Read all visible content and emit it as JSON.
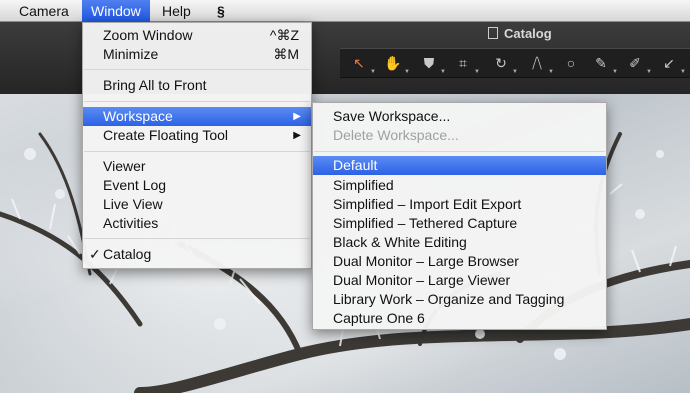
{
  "menubar": {
    "items": [
      {
        "label": "Camera"
      },
      {
        "label": "Window"
      },
      {
        "label": "Help"
      }
    ],
    "script_icon": "script-menu-icon"
  },
  "window": {
    "title": "Catalog"
  },
  "toolbar": {
    "tools": [
      {
        "icon": "cursor-icon",
        "glyph": "↖"
      },
      {
        "icon": "hand-icon",
        "glyph": "✋"
      },
      {
        "icon": "stamp-icon",
        "glyph": "⛊"
      },
      {
        "icon": "crop-icon",
        "glyph": "⌗"
      },
      {
        "icon": "rotate-icon",
        "glyph": "↻"
      },
      {
        "icon": "keystone-icon",
        "glyph": "⧸⧹"
      },
      {
        "icon": "spot-icon",
        "glyph": "○"
      },
      {
        "icon": "brush-icon",
        "glyph": "✎"
      },
      {
        "icon": "picker-icon",
        "glyph": "✐"
      },
      {
        "icon": "arrow-icon",
        "glyph": "↙"
      }
    ]
  },
  "window_menu": {
    "items": [
      {
        "label": "Zoom Window",
        "shortcut": "^⌘Z"
      },
      {
        "label": "Minimize",
        "shortcut": "⌘M"
      },
      {
        "label": "Bring All to Front"
      },
      {
        "label": "Workspace"
      },
      {
        "label": "Create Floating Tool"
      },
      {
        "label": "Viewer"
      },
      {
        "label": "Event Log"
      },
      {
        "label": "Live View"
      },
      {
        "label": "Activities"
      },
      {
        "label": "Catalog",
        "check": "✓"
      }
    ],
    "submenu_arrow": "▶"
  },
  "workspace_menu": {
    "items": [
      {
        "label": "Save Workspace..."
      },
      {
        "label": "Delete Workspace..."
      },
      {
        "label": "Default"
      },
      {
        "label": "Simplified"
      },
      {
        "label": "Simplified – Import Edit Export"
      },
      {
        "label": "Simplified – Tethered Capture"
      },
      {
        "label": "Black & White Editing"
      },
      {
        "label": "Dual Monitor – Large Browser"
      },
      {
        "label": "Dual Monitor – Large Viewer"
      },
      {
        "label": "Library Work – Organize and Tagging"
      },
      {
        "label": "Capture One 6"
      }
    ]
  },
  "colors": {
    "highlight": "#2c62e6",
    "toolbar": "#2b2b2b",
    "accent_tool": "#f07a3c"
  }
}
